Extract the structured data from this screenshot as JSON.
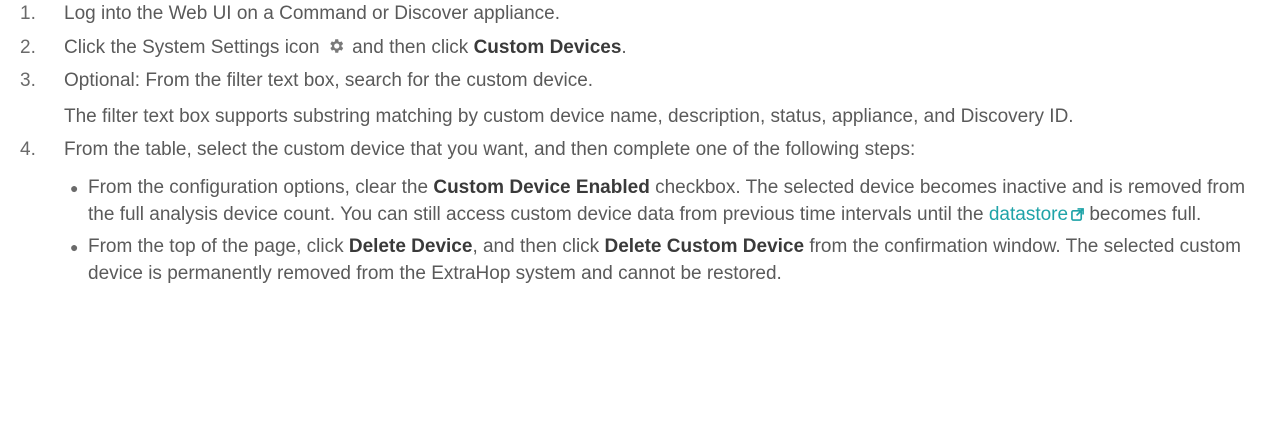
{
  "steps": [
    {
      "num": "1.",
      "text": "Log into the Web UI on a Command or Discover appliance."
    },
    {
      "num": "2.",
      "before": "Click the System Settings icon",
      "icon": "gear-icon",
      "middle": "and then click",
      "bold": "Custom Devices",
      "after": "."
    },
    {
      "num": "3.",
      "text": "Optional: From the filter text box, search for the custom device.",
      "note": "The filter text box supports substring matching by custom device name, description, status, appliance, and Discovery ID."
    },
    {
      "num": "4.",
      "text": "From the table, select the custom device that you want, and then complete one of the following steps:",
      "bullets": [
        {
          "t1": "From the configuration options, clear the",
          "b1": "Custom Device Enabled",
          "t2": "checkbox. The selected device becomes inactive and is removed from the full analysis device count. You can still access custom device data from previous time intervals until the",
          "link": "datastore",
          "t3": "becomes full."
        },
        {
          "t1": "From the top of the page, click",
          "b1": "Delete Device",
          "t2": ", and then click",
          "b2": "Delete Custom Device",
          "t3": "from the confirmation window. The selected custom device is permanently removed from the ExtraHop system and cannot be restored."
        }
      ]
    }
  ],
  "colors": {
    "text": "#5a5a5a",
    "bold": "#3a3a3a",
    "link": "#1fa3a8"
  }
}
